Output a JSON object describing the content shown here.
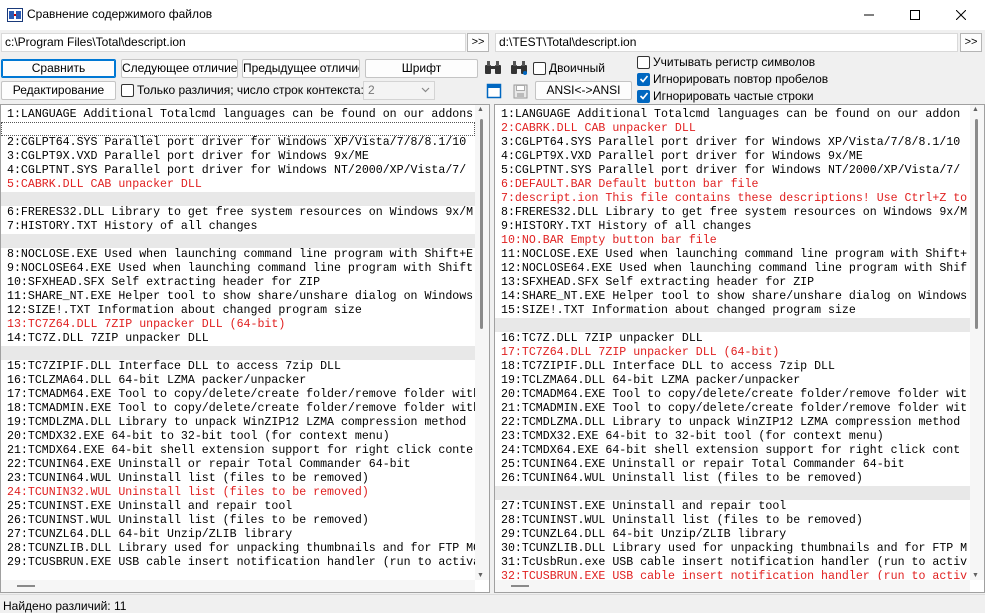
{
  "window": {
    "title": "Сравнение содержимого файлов",
    "icon": "compare-files-icon"
  },
  "left_path": {
    "value": "c:\\Program Files\\Total\\descript.ion",
    "browse": ">>"
  },
  "right_path": {
    "value": "d:\\TEST\\Total\\descript.ion",
    "browse": ">>"
  },
  "toolbar": {
    "compare": "Сравнить",
    "next_diff": "Следующее отличие",
    "prev_diff": "Предыдущее отличие",
    "font": "Шрифт",
    "edit": "Редактирование",
    "ansi": "ANSI<->ANSI",
    "only_diffs": "Только различия; число строк контекста:",
    "context_lines": "2",
    "binary": "Двоичный",
    "case_sensitive": "Учитывать регистр символов",
    "ignore_spaces": "Игнорировать повтор пробелов",
    "ignore_frequent": "Игнорировать частые строки"
  },
  "checks": {
    "only_diffs": false,
    "binary": false,
    "case_sensitive": false,
    "ignore_spaces": true,
    "ignore_frequent": true
  },
  "left_lines": [
    {
      "t": "1:LANGUAGE Additional Totalcmd languages can be found on our addons",
      "k": "n"
    },
    {
      "t": "",
      "k": "c"
    },
    {
      "t": "2:CGLPT64.SYS Parallel port driver for Windows XP/Vista/7/8/8.1/10",
      "k": "n"
    },
    {
      "t": "3:CGLPT9X.VXD Parallel port driver for Windows 9x/ME",
      "k": "n"
    },
    {
      "t": "4:CGLPTNT.SYS Parallel port driver for Windows NT/2000/XP/Vista/7/",
      "k": "n"
    },
    {
      "t": "5:CABRK.DLL CAB unpacker DLL",
      "k": "d"
    },
    {
      "t": "",
      "k": "b"
    },
    {
      "t": "6:FRERES32.DLL Library to get free system resources on Windows 9x/M",
      "k": "n"
    },
    {
      "t": "7:HISTORY.TXT History of all changes",
      "k": "n"
    },
    {
      "t": "",
      "k": "b"
    },
    {
      "t": "8:NOCLOSE.EXE Used when launching command line program with Shift+E",
      "k": "n"
    },
    {
      "t": "9:NOCLOSE64.EXE Used when launching command line program with Shift",
      "k": "n"
    },
    {
      "t": "10:SFXHEAD.SFX Self extracting header for ZIP",
      "k": "n"
    },
    {
      "t": "11:SHARE_NT.EXE Helper tool to show share/unshare dialog on Windows",
      "k": "n"
    },
    {
      "t": "12:SIZE!.TXT Information about changed program size",
      "k": "n"
    },
    {
      "t": "13:TC7Z64.DLL 7ZIP unpacker DLL (64-bit)",
      "k": "d"
    },
    {
      "t": "14:TC7Z.DLL 7ZIP unpacker DLL",
      "k": "n"
    },
    {
      "t": "",
      "k": "b"
    },
    {
      "t": "15:TC7ZIPIF.DLL Interface DLL to access 7zip DLL",
      "k": "n"
    },
    {
      "t": "16:TCLZMA64.DLL 64-bit LZMA packer/unpacker",
      "k": "n"
    },
    {
      "t": "17:TCMADM64.EXE Tool to copy/delete/create folder/remove folder with",
      "k": "n"
    },
    {
      "t": "18:TCMADMIN.EXE Tool to copy/delete/create folder/remove folder with",
      "k": "n"
    },
    {
      "t": "19:TCMDLZMA.DLL Library to unpack WinZIP12 LZMA compression method",
      "k": "n"
    },
    {
      "t": "20:TCMDX32.EXE 64-bit to 32-bit tool (for context menu)",
      "k": "n"
    },
    {
      "t": "21:TCMDX64.EXE 64-bit shell extension support for right click conte",
      "k": "n"
    },
    {
      "t": "22:TCUNIN64.EXE Uninstall or repair Total Commander 64-bit",
      "k": "n"
    },
    {
      "t": "23:TCUNIN64.WUL Uninstall list (files to be removed)",
      "k": "n"
    },
    {
      "t": "24:TCUNIN32.WUL Uninstall list (files to be removed)",
      "k": "d"
    },
    {
      "t": "25:TCUNINST.EXE Uninstall and repair tool",
      "k": "n"
    },
    {
      "t": "26:TCUNINST.WUL Uninstall list (files to be removed)",
      "k": "n"
    },
    {
      "t": "27:TCUNZL64.DLL 64-bit Unzip/ZLIB library",
      "k": "n"
    },
    {
      "t": "28:TCUNZLIB.DLL Library used for unpacking thumbnails and for FTP MO",
      "k": "n"
    },
    {
      "t": "29:TCUSBRUN.EXE USB cable insert notification handler (run to activa",
      "k": "n"
    }
  ],
  "right_lines": [
    {
      "t": "1:LANGUAGE Additional Totalcmd languages can be found on our addon",
      "k": "n"
    },
    {
      "t": "2:CABRK.DLL CAB unpacker DLL",
      "k": "d"
    },
    {
      "t": "3:CGLPT64.SYS Parallel port driver for Windows XP/Vista/7/8/8.1/10",
      "k": "n"
    },
    {
      "t": "4:CGLPT9X.VXD Parallel port driver for Windows 9x/ME",
      "k": "n"
    },
    {
      "t": "5:CGLPTNT.SYS Parallel port driver for Windows NT/2000/XP/Vista/7/",
      "k": "n"
    },
    {
      "t": "6:DEFAULT.BAR Default button bar file",
      "k": "d"
    },
    {
      "t": "7:descript.ion This file contains these descriptions! Use Ctrl+Z to",
      "k": "d"
    },
    {
      "t": "8:FRERES32.DLL Library to get free system resources on Windows 9x/M",
      "k": "n"
    },
    {
      "t": "9:HISTORY.TXT History of all changes",
      "k": "n"
    },
    {
      "t": "10:NO.BAR Empty button bar file",
      "k": "d"
    },
    {
      "t": "11:NOCLOSE.EXE Used when launching command line program with Shift+",
      "k": "n"
    },
    {
      "t": "12:NOCLOSE64.EXE Used when launching command line program with Shif",
      "k": "n"
    },
    {
      "t": "13:SFXHEAD.SFX Self extracting header for ZIP",
      "k": "n"
    },
    {
      "t": "14:SHARE_NT.EXE Helper tool to show share/unshare dialog on Windows",
      "k": "n"
    },
    {
      "t": "15:SIZE!.TXT Information about changed program size",
      "k": "n"
    },
    {
      "t": "",
      "k": "b"
    },
    {
      "t": "16:TC7Z.DLL 7ZIP unpacker DLL",
      "k": "n"
    },
    {
      "t": "17:TC7Z64.DLL 7ZIP unpacker DLL (64-bit)",
      "k": "d"
    },
    {
      "t": "18:TC7ZIPIF.DLL Interface DLL to access 7zip DLL",
      "k": "n"
    },
    {
      "t": "19:TCLZMA64.DLL 64-bit LZMA packer/unpacker",
      "k": "n"
    },
    {
      "t": "20:TCMADM64.EXE Tool to copy/delete/create folder/remove folder wit",
      "k": "n"
    },
    {
      "t": "21:TCMADMIN.EXE Tool to copy/delete/create folder/remove folder wit",
      "k": "n"
    },
    {
      "t": "22:TCMDLZMA.DLL Library to unpack WinZIP12 LZMA compression method",
      "k": "n"
    },
    {
      "t": "23:TCMDX32.EXE 64-bit to 32-bit tool (for context menu)",
      "k": "n"
    },
    {
      "t": "24:TCMDX64.EXE 64-bit shell extension support for right click cont",
      "k": "n"
    },
    {
      "t": "25:TCUNIN64.EXE Uninstall or repair Total Commander 64-bit",
      "k": "n"
    },
    {
      "t": "26:TCUNIN64.WUL Uninstall list (files to be removed)",
      "k": "n"
    },
    {
      "t": "",
      "k": "b"
    },
    {
      "t": "27:TCUNINST.EXE Uninstall and repair tool",
      "k": "n"
    },
    {
      "t": "28:TCUNINST.WUL Uninstall list (files to be removed)",
      "k": "n"
    },
    {
      "t": "29:TCUNZL64.DLL 64-bit Unzip/ZLIB library",
      "k": "n"
    },
    {
      "t": "30:TCUNZLIB.DLL Library used for unpacking thumbnails and for FTP M",
      "k": "n"
    },
    {
      "t": "31:TcUsbRun.exe USB cable insert notification handler (run to activ",
      "k": "n"
    },
    {
      "t": "32:TCUSBRUN.EXE USB cable insert notification handler (run to activ",
      "k": "d"
    }
  ],
  "status": "Найдено различий: 11",
  "colors": {
    "diff_text": "#e02020",
    "blank_line": "#e8e8e8",
    "accent": "#0067c0"
  }
}
